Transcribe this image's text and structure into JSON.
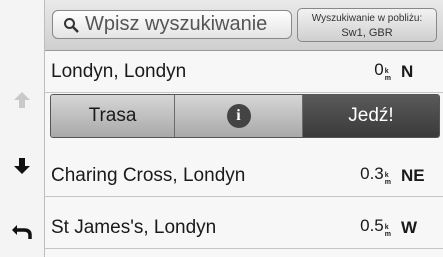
{
  "search": {
    "placeholder": "Wpisz wyszukiwanie",
    "near_line1": "Wyszukiwanie w pobliżu:",
    "near_line2": "Sw1, GBR"
  },
  "selected": {
    "name": "Londyn, Londyn",
    "distance_value": "0",
    "distance_unit_top": "k",
    "distance_unit_bottom": "m",
    "direction": "N"
  },
  "actions": {
    "route_label": "Trasa",
    "info_glyph": "i",
    "go_label": "Jedź!"
  },
  "results": [
    {
      "name": "Charing Cross, Londyn",
      "distance_value": "0.3",
      "distance_unit_top": "k",
      "distance_unit_bottom": "m",
      "direction": "NE"
    },
    {
      "name": "St James's, Londyn",
      "distance_value": "0.5",
      "distance_unit_top": "k",
      "distance_unit_bottom": "m",
      "direction": "W"
    }
  ],
  "icons": {
    "scroll_up": "arrow-up-icon",
    "scroll_down": "arrow-down-icon",
    "back": "back-icon",
    "search": "search-icon",
    "info": "info-icon"
  },
  "colors": {
    "go_button": "#3a3a3a",
    "disabled_arrow": "#c9c9c9"
  }
}
